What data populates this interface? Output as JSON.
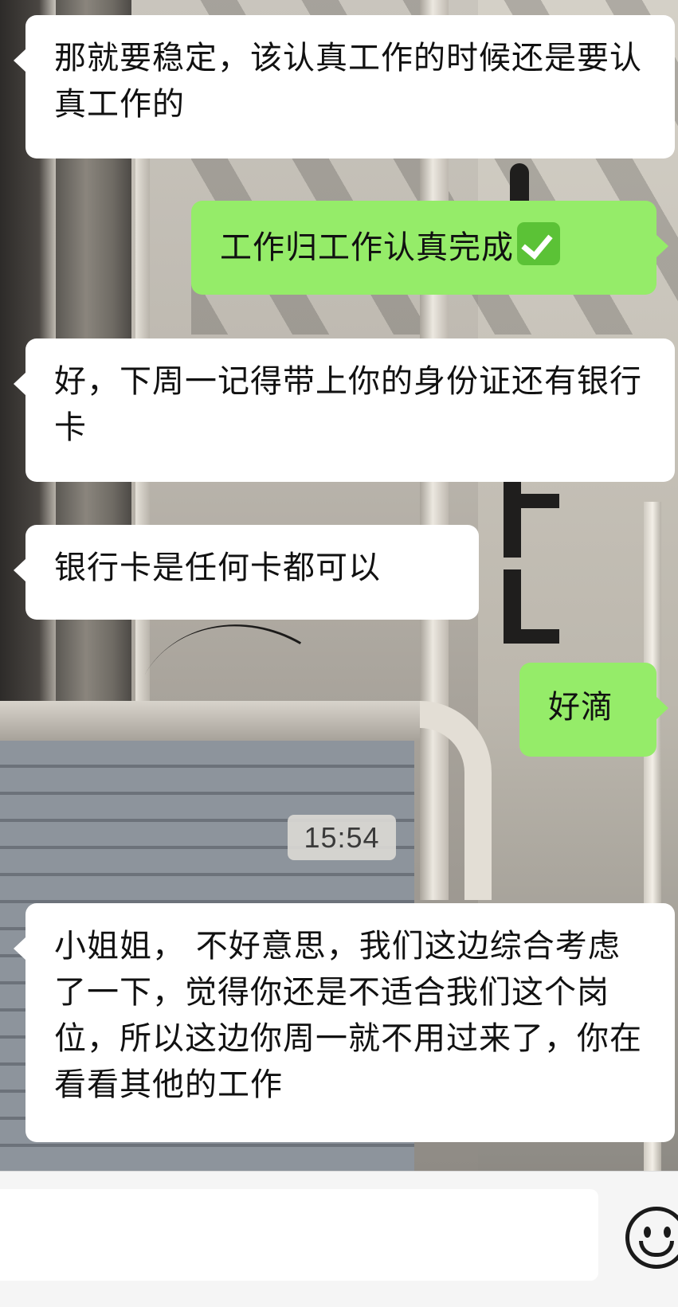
{
  "messages": [
    {
      "side": "incoming",
      "text": "那就要稳定，该认真工作的时候还是要认真工作的"
    },
    {
      "side": "outgoing",
      "text": "工作归工作认真完成",
      "emoji": "white-check-mark-emoji"
    },
    {
      "side": "incoming",
      "text": "好，下周一记得带上你的身份证还有银行卡"
    },
    {
      "side": "incoming",
      "text": "银行卡是任何卡都可以"
    },
    {
      "side": "outgoing",
      "text": "好滴"
    },
    {
      "side": "incoming",
      "text": "小姐姐， 不好意思，我们这边综合考虑了一下，觉得你还是不适合我们这个岗位，所以这边你周一就不用过来了，你在看看其他的工作"
    }
  ],
  "timestamp": "15:54",
  "input_bar": {
    "value": "",
    "emoji_button_icon": "smiley-face-icon"
  },
  "colors": {
    "incoming_bubble": "#ffffff",
    "outgoing_bubble": "#95ec69",
    "input_bar_bg": "#f5f5f5"
  }
}
